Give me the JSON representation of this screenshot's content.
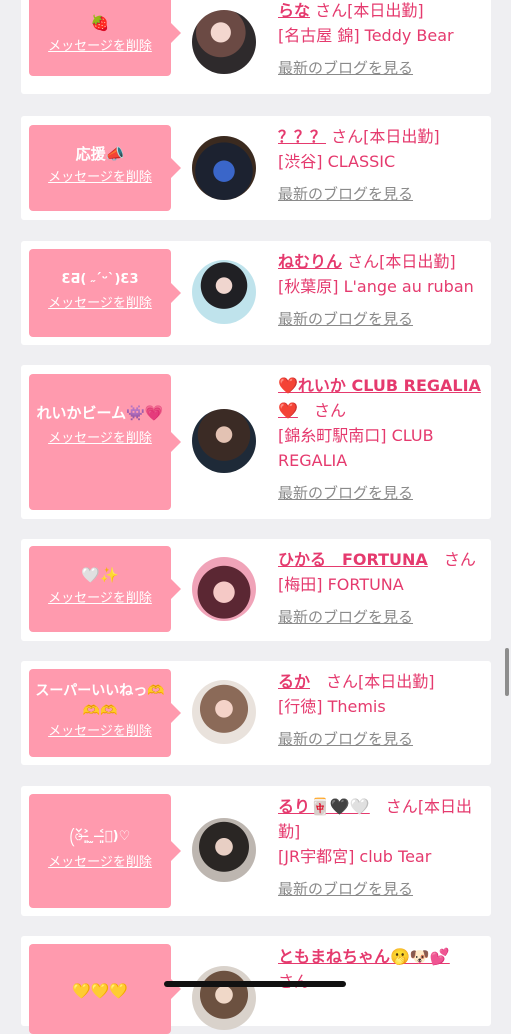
{
  "cards": [
    {
      "message": "🍓",
      "delete_label": "メッセージを削除",
      "name": "らな",
      "san": "さん",
      "status": "[本日出勤]",
      "shop": "[名古屋 錦] Teddy Bear",
      "blog": "最新のブログを見る"
    },
    {
      "message": "応援📣",
      "delete_label": "メッセージを削除",
      "name": "？？？",
      "san": "さん",
      "status": "[本日出勤]",
      "shop": "[渋谷] CLASSIC",
      "blog": "最新のブログを見る"
    },
    {
      "message": "ƐƋ( ˶ˊᵕˋ)Ɛ3",
      "delete_label": "メッセージを削除",
      "name": "ねむりん",
      "san": "さん",
      "status": "[本日出勤]",
      "shop": "[秋葉原] L'ange au ruban",
      "blog": "最新のブログを見る"
    },
    {
      "message": "れいかビーム👾💗",
      "delete_label": "メッセージを削除",
      "name": "❤️れいか CLUB REGALIA❤️",
      "san": "さん",
      "status": "",
      "shop": "[錦糸町駅南口] CLUB REGALIA",
      "blog": "最新のブログを見る"
    },
    {
      "message": "🤍✨",
      "delete_label": "メッセージを削除",
      "name": "ひかる　FORTUNA",
      "san": "さん",
      "status": "",
      "shop": "[梅田] FORTUNA",
      "blog": "最新のブログを見る"
    },
    {
      "message": "スーパーいいねっ🫶🫶🫶",
      "delete_label": "メッセージを削除",
      "name": "るか",
      "san": "さん",
      "status": "[本日出勤]",
      "shop": "[行徳] Themis",
      "blog": "最新のブログを見る"
    },
    {
      "message": "(ၴ˃̶͈ ̫ ˂̶͈ၴ)♡",
      "delete_label": "メッセージを削除",
      "name": "るり🀄🖤🤍",
      "san": "さん",
      "status": "[本日出勤]",
      "shop": "[JR宇都宮] club Tear",
      "blog": "最新のブログを見る"
    },
    {
      "message": "💛💛💛",
      "delete_label": "",
      "name": "ともまねちゃん🫢🐶💕",
      "san": "さん",
      "status": "",
      "shop": "",
      "blog": ""
    }
  ],
  "colors": {
    "accent": "#e53a6e",
    "bubble": "#ff9aae",
    "background": "#efeff2"
  }
}
